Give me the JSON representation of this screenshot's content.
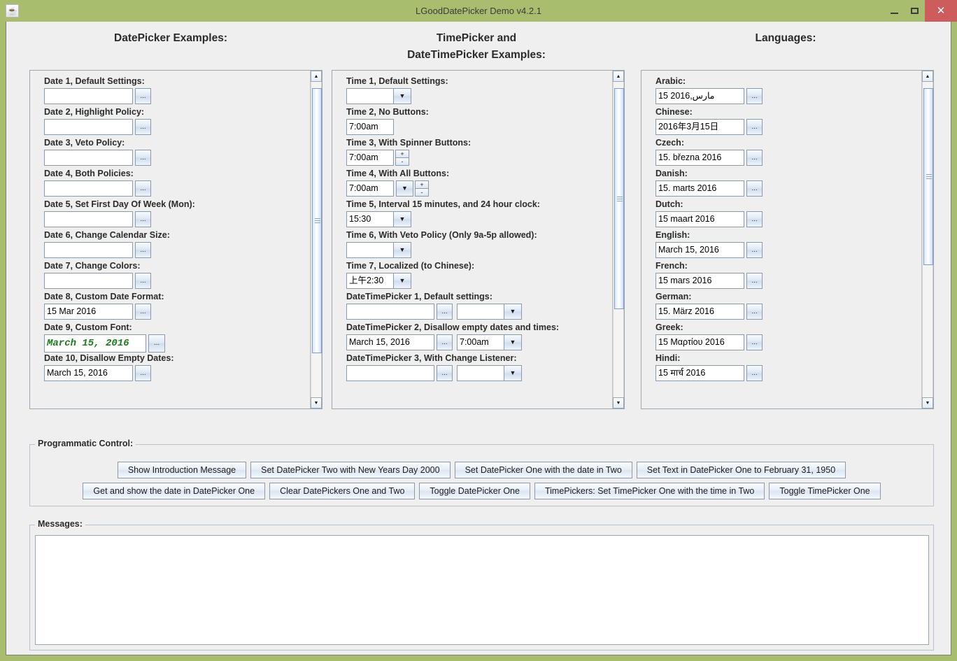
{
  "window": {
    "title": "LGoodDatePicker Demo v4.2.1",
    "app_icon": "java-coffee-cup-icon",
    "minimize_label": "Minimize",
    "maximize_label": "Maximize",
    "close_label": "✕",
    "titlebar_color": "#a9bd6e",
    "close_button_color": "#cd5c5c",
    "client_background": "#efefef"
  },
  "headers": {
    "dates": "DatePicker Examples:",
    "times_line1": "TimePicker and",
    "times_line2": "DateTimePicker Examples:",
    "languages": "Languages:"
  },
  "icons": {
    "dots": "...",
    "arrow_down": "▼",
    "arrow_up": "▲",
    "plus": "+",
    "minus": "-"
  },
  "date_panel": {
    "items": [
      {
        "label": "Date 1, Default Settings:",
        "value": "",
        "button": "..."
      },
      {
        "label": "Date 2, Highlight Policy:",
        "value": "",
        "button": "..."
      },
      {
        "label": "Date 3, Veto Policy:",
        "value": "",
        "button": "..."
      },
      {
        "label": "Date 4, Both Policies:",
        "value": "",
        "button": "..."
      },
      {
        "label": "Date 5, Set First Day Of Week (Mon):",
        "value": "",
        "button": "..."
      },
      {
        "label": "Date 6, Change Calendar Size:",
        "value": "",
        "button": "..."
      },
      {
        "label": "Date 7, Change Colors:",
        "value": "",
        "button": "..."
      },
      {
        "label": "Date 8, Custom Date Format:",
        "value": "15 Mar 2016",
        "button": "..."
      },
      {
        "label": "Date 9, Custom Font:",
        "value": "March 15, 2016",
        "button": "...",
        "custom_font": true,
        "font_color": "#1d7a1d"
      },
      {
        "label": "Date 10, Disallow Empty Dates:",
        "value": "March 15, 2016",
        "button": "..."
      }
    ],
    "scroll_thumb_top_pct": 2,
    "scroll_thumb_height_pct": 84
  },
  "time_panel": {
    "items": [
      {
        "label": "Time 1, Default Settings:",
        "value": "",
        "controls": [
          "combo"
        ]
      },
      {
        "label": "Time 2, No Buttons:",
        "value": "7:00am",
        "controls": []
      },
      {
        "label": "Time 3, With Spinner Buttons:",
        "value": "7:00am",
        "controls": [
          "spinner"
        ]
      },
      {
        "label": "Time 4, With All Buttons:",
        "value": "7:00am",
        "controls": [
          "combo",
          "spinner"
        ]
      },
      {
        "label": "Time 5, Interval 15 minutes, and 24 hour clock:",
        "value": "15:30",
        "controls": [
          "combo"
        ]
      },
      {
        "label": "Time 6, With Veto Policy (Only 9a-5p allowed):",
        "value": "",
        "controls": [
          "combo"
        ]
      },
      {
        "label": "Time 7, Localized (to Chinese):",
        "value": "上午2:30",
        "controls": [
          "combo"
        ]
      },
      {
        "label": "DateTimePicker 1, Default settings:",
        "date_value": "",
        "time_value": "",
        "controls": [
          "datetime"
        ]
      },
      {
        "label": "DateTimePicker 2, Disallow empty dates and times:",
        "date_value": "March 15, 2016",
        "time_value": "7:00am",
        "controls": [
          "datetime"
        ]
      },
      {
        "label": "DateTimePicker 3, With Change Listener:",
        "date_value": "",
        "time_value": "",
        "controls": [
          "datetime"
        ]
      }
    ],
    "scroll_thumb_top_pct": 2,
    "scroll_thumb_height_pct": 70
  },
  "language_panel": {
    "items": [
      {
        "label": "Arabic:",
        "value": "مارس,2016 15",
        "button": "..."
      },
      {
        "label": "Chinese:",
        "value": "2016年3月15日",
        "button": "..."
      },
      {
        "label": "Czech:",
        "value": "15. března 2016",
        "button": "..."
      },
      {
        "label": "Danish:",
        "value": "15. marts 2016",
        "button": "..."
      },
      {
        "label": "Dutch:",
        "value": "15 maart 2016",
        "button": "..."
      },
      {
        "label": "English:",
        "value": "March 15, 2016",
        "button": "..."
      },
      {
        "label": "French:",
        "value": "15 mars 2016",
        "button": "..."
      },
      {
        "label": "German:",
        "value": "15. März 2016",
        "button": "..."
      },
      {
        "label": "Greek:",
        "value": "15 Μαρτίου 2016",
        "button": "..."
      },
      {
        "label": "Hindi:",
        "value": "15 मार्च 2016",
        "button": "..."
      }
    ],
    "scroll_thumb_top_pct": 2,
    "scroll_thumb_height_pct": 56
  },
  "programmatic_control": {
    "title": "Programmatic Control:",
    "row1": [
      "Show Introduction Message",
      "Set DatePicker Two with New Years Day 2000",
      "Set DatePicker One with the date in Two",
      "Set Text in DatePicker One to February 31, 1950"
    ],
    "row2": [
      "Get and show the date in DatePicker One",
      "Clear DatePickers One and Two",
      "Toggle DatePicker One",
      "TimePickers: Set TimePicker One with the time in Two",
      "Toggle TimePicker One"
    ]
  },
  "messages": {
    "title": "Messages:",
    "content": ""
  }
}
